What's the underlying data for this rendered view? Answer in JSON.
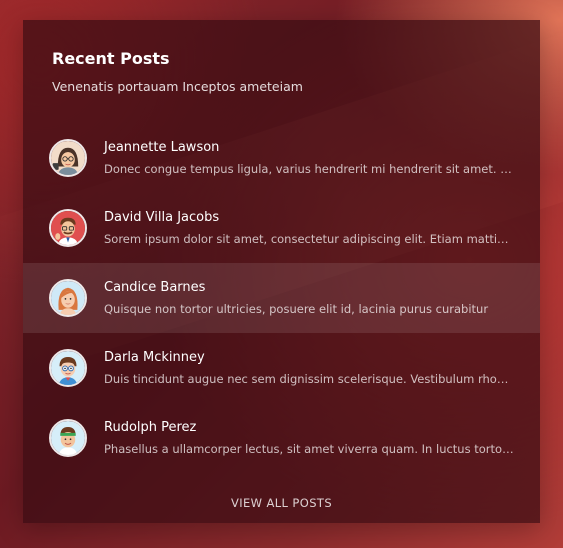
{
  "widget": {
    "title": "Recent Posts",
    "subtitle": "Venenatis portauam Inceptos ameteiam",
    "view_all_label": "VIEW ALL POSTS"
  },
  "posts": [
    {
      "name": "Jeannette Lawson",
      "excerpt": "Donec congue tempus ligula, varius hendrerit mi hendrerit sit amet. Duis ac quam sit amet leo feugiat",
      "avatar_icon": "woman-with-glasses-avatar-icon",
      "avatar_bg": "#f2dcc9",
      "active": false
    },
    {
      "name": "David Villa Jacobs",
      "excerpt": "Sorem ipsum dolor sit amet, consectetur adipiscing elit. Etiam mattis lobortis sapien non posuere",
      "avatar_icon": "man-with-glasses-avatar-icon",
      "avatar_bg": "#e04f4f",
      "active": false
    },
    {
      "name": "Candice Barnes",
      "excerpt": "Quisque non tortor ultricies, posuere elit id, lacinia purus curabitur",
      "avatar_icon": "woman-redhead-avatar-icon",
      "avatar_bg": "#cfe9f7",
      "active": true
    },
    {
      "name": "Darla Mckinney",
      "excerpt": "Duis tincidunt augue nec sem dignissim scelerisque. Vestibulum rhoncus sapien sed nulla aliquam",
      "avatar_icon": "boy-with-glasses-avatar-icon",
      "avatar_bg": "#d6eef9",
      "active": false
    },
    {
      "name": "Rudolph Perez",
      "excerpt": "Phasellus a ullamcorper lectus, sit amet viverra quam. In luctus tortor vel nulla pharetra bibendum",
      "avatar_icon": "man-with-headband-avatar-icon",
      "avatar_bg": "#d6eef9",
      "active": false
    }
  ]
}
